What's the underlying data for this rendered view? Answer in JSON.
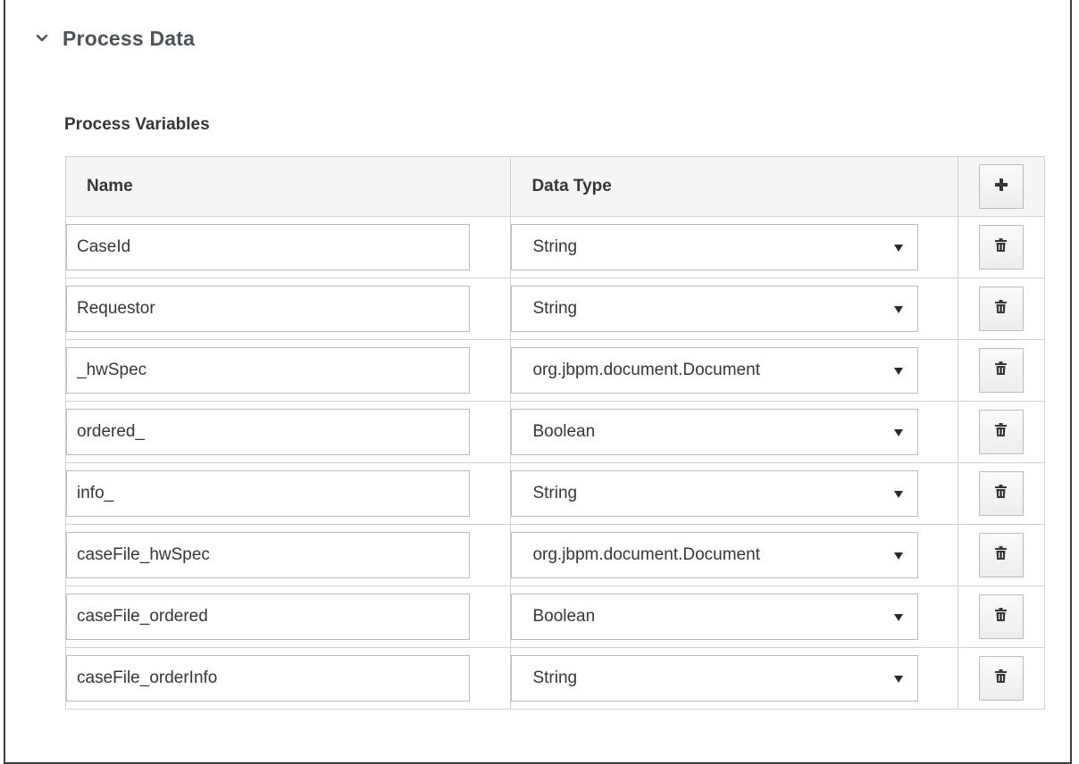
{
  "section": {
    "title": "Process Data",
    "expanded_icon": "chevron-down-icon"
  },
  "process_variables": {
    "label": "Process Variables",
    "columns": {
      "name": "Name",
      "data_type": "Data Type"
    },
    "add_icon": "plus-icon",
    "delete_icon": "trash-icon",
    "rows": [
      {
        "name": "CaseId",
        "data_type": "String"
      },
      {
        "name": "Requestor",
        "data_type": "String"
      },
      {
        "name": "_hwSpec",
        "data_type": "org.jbpm.document.Document"
      },
      {
        "name": "ordered_",
        "data_type": "Boolean"
      },
      {
        "name": "info_",
        "data_type": "String"
      },
      {
        "name": "caseFile_hwSpec",
        "data_type": "org.jbpm.document.Document"
      },
      {
        "name": "caseFile_ordered",
        "data_type": "Boolean"
      },
      {
        "name": "caseFile_orderInfo",
        "data_type": "String"
      }
    ]
  }
}
